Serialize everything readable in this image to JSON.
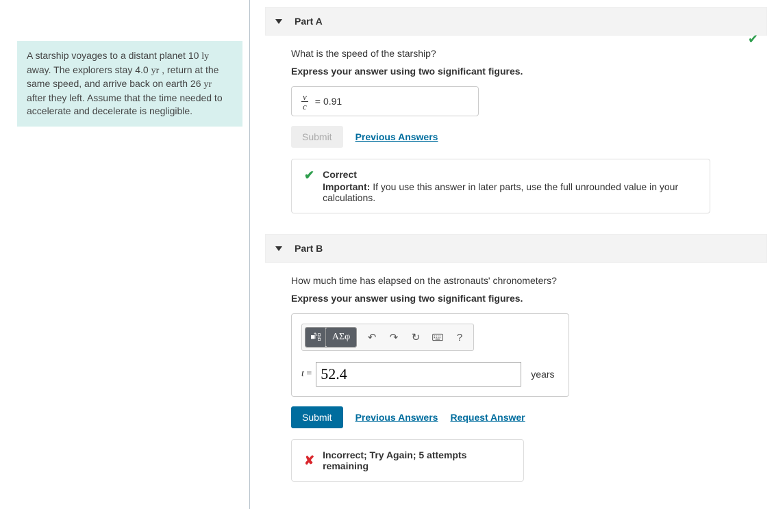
{
  "problem": {
    "text_pre": "A starship voyages to a distant planet 10 ",
    "unit1": "ly",
    "text_mid1": " away. The explorers stay 4.0 ",
    "unit2": "yr",
    "text_mid2": " , return at the same speed, and arrive back on earth 26 ",
    "unit3": "yr",
    "text_post": " after they left. Assume that the time needed to accelerate and decelerate is negligible."
  },
  "partA": {
    "title": "Part A",
    "question": "What is the speed of the starship?",
    "instruction": "Express your answer using two significant figures.",
    "var_num": "v",
    "var_den": "c",
    "eq": "=",
    "value": "0.91",
    "submit": "Submit",
    "prev": "Previous Answers",
    "correct_label": "Correct",
    "important_label": "Important:",
    "important_text": " If you use this answer in later parts, use the full unrounded value in your calculations."
  },
  "partB": {
    "title": "Part B",
    "question": "How much time has elapsed on the astronauts' chronometers?",
    "instruction": "Express your answer using two significant figures.",
    "greek_label": "ΑΣφ",
    "var": "t",
    "eq": " = ",
    "value": "52.4",
    "units": "years",
    "submit": "Submit",
    "prev": "Previous Answers",
    "request": "Request Answer",
    "incorrect_text": "Incorrect; Try Again; 5 attempts remaining"
  }
}
